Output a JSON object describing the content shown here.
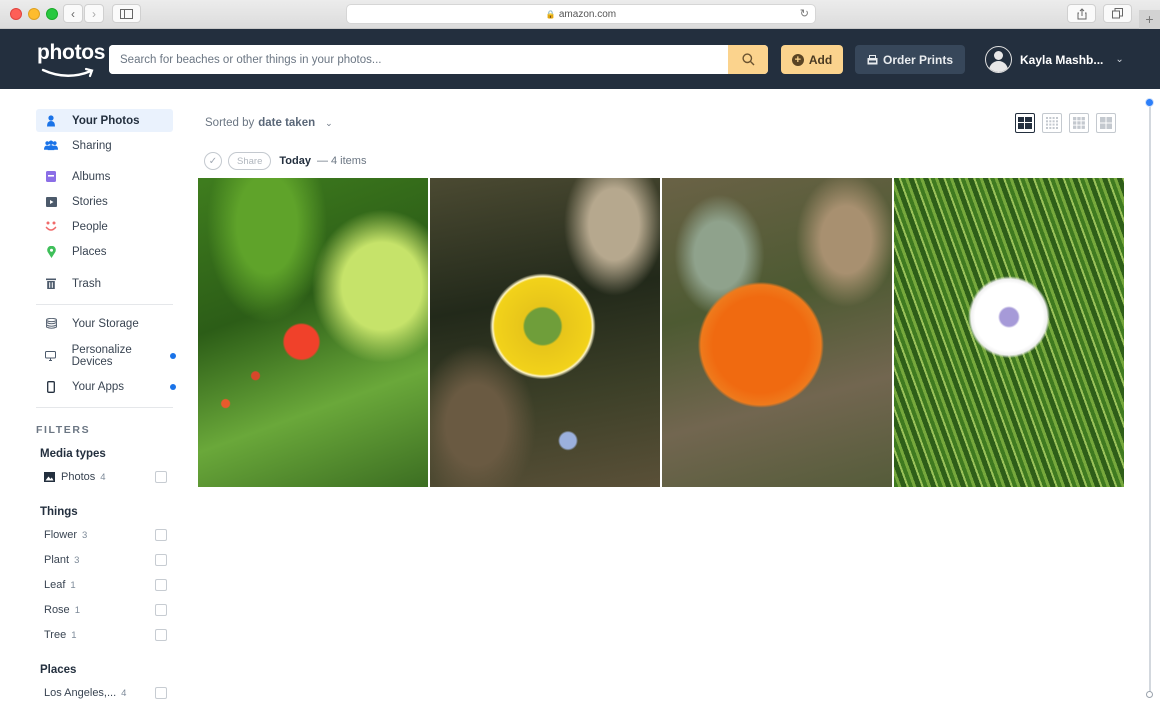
{
  "browser": {
    "url": "amazon.com",
    "buttons": {
      "back": "‹",
      "forward": "›",
      "new_tab": "+"
    }
  },
  "header": {
    "logo_text": "photos",
    "search_placeholder": "Search for beaches or other things in your photos...",
    "add_label": "Add",
    "order_prints_label": "Order Prints",
    "user_name": "Kayla Mashb...",
    "colors": {
      "bar": "#232f3e",
      "accent": "#fbd38d"
    }
  },
  "sidebar": {
    "nav": [
      {
        "label": "Your Photos",
        "icon": "person-icon",
        "active": true
      },
      {
        "label": "Sharing",
        "icon": "people-icon"
      },
      {
        "label": "Albums",
        "icon": "album-icon"
      },
      {
        "label": "Stories",
        "icon": "play-icon"
      },
      {
        "label": "People",
        "icon": "smile-icon"
      },
      {
        "label": "Places",
        "icon": "map-pin-icon"
      },
      {
        "label": "Trash",
        "icon": "trash-icon"
      }
    ],
    "secondary": [
      {
        "label": "Your Storage",
        "icon": "storage-icon",
        "badge": false
      },
      {
        "label": "Personalize Devices",
        "icon": "monitor-icon",
        "badge": true
      },
      {
        "label": "Your Apps",
        "icon": "phone-icon",
        "badge": true
      }
    ],
    "filters_title": "FILTERS",
    "media_types": {
      "title": "Media types",
      "items": [
        {
          "label": "Photos",
          "count": "4",
          "checked": false
        }
      ]
    },
    "things": {
      "title": "Things",
      "items": [
        {
          "label": "Flower",
          "count": "3",
          "checked": false
        },
        {
          "label": "Plant",
          "count": "3",
          "checked": false
        },
        {
          "label": "Leaf",
          "count": "1",
          "checked": false
        },
        {
          "label": "Rose",
          "count": "1",
          "checked": false
        },
        {
          "label": "Tree",
          "count": "1",
          "checked": false
        }
      ]
    },
    "places": {
      "title": "Places",
      "items": [
        {
          "label": "Los Angeles,...",
          "count": "4",
          "checked": false
        }
      ]
    }
  },
  "main": {
    "sort_prefix": "Sorted by",
    "sort_value": "date taken",
    "view_modes": [
      "mosaic",
      "small-grid",
      "medium-grid",
      "large-grid"
    ],
    "active_view": "mosaic",
    "group": {
      "share_label": "Share",
      "title": "Today",
      "count_text": "— 4 items"
    },
    "photos": [
      {
        "subject": "red pomegranate flower"
      },
      {
        "subject": "yellow flower"
      },
      {
        "subject": "orange poppy"
      },
      {
        "subject": "white iris"
      }
    ]
  }
}
